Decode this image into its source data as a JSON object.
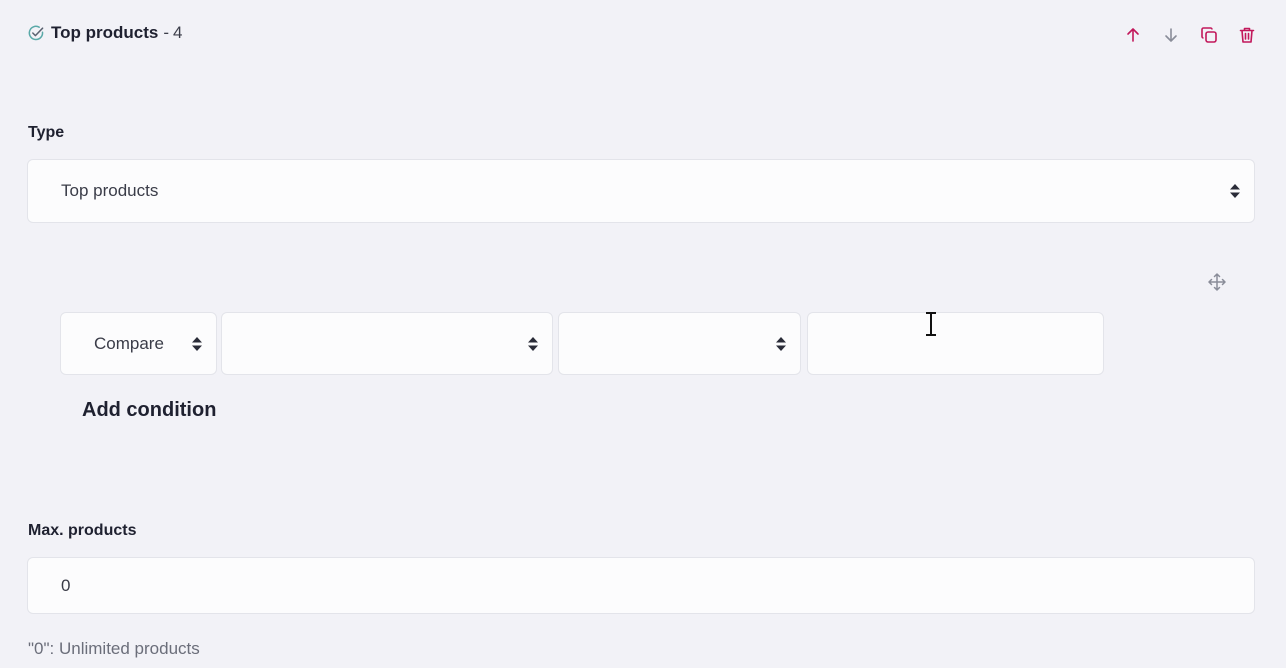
{
  "header": {
    "title": "Top products",
    "separator": "-",
    "number": "4",
    "check_icon": "check-circle-icon",
    "actions": [
      "arrow-up-icon",
      "arrow-down-icon",
      "duplicate-icon",
      "trash-icon"
    ],
    "action_color": "#c2185b"
  },
  "type": {
    "label": "Type",
    "selected": "Top products"
  },
  "condition": {
    "compare": "Compare",
    "field": "",
    "operator": "",
    "value": "",
    "move_icon": "move-icon",
    "add_label": "Add condition"
  },
  "max_products": {
    "label": "Max. products",
    "value": "0",
    "hint": "\"0\": Unlimited products"
  }
}
